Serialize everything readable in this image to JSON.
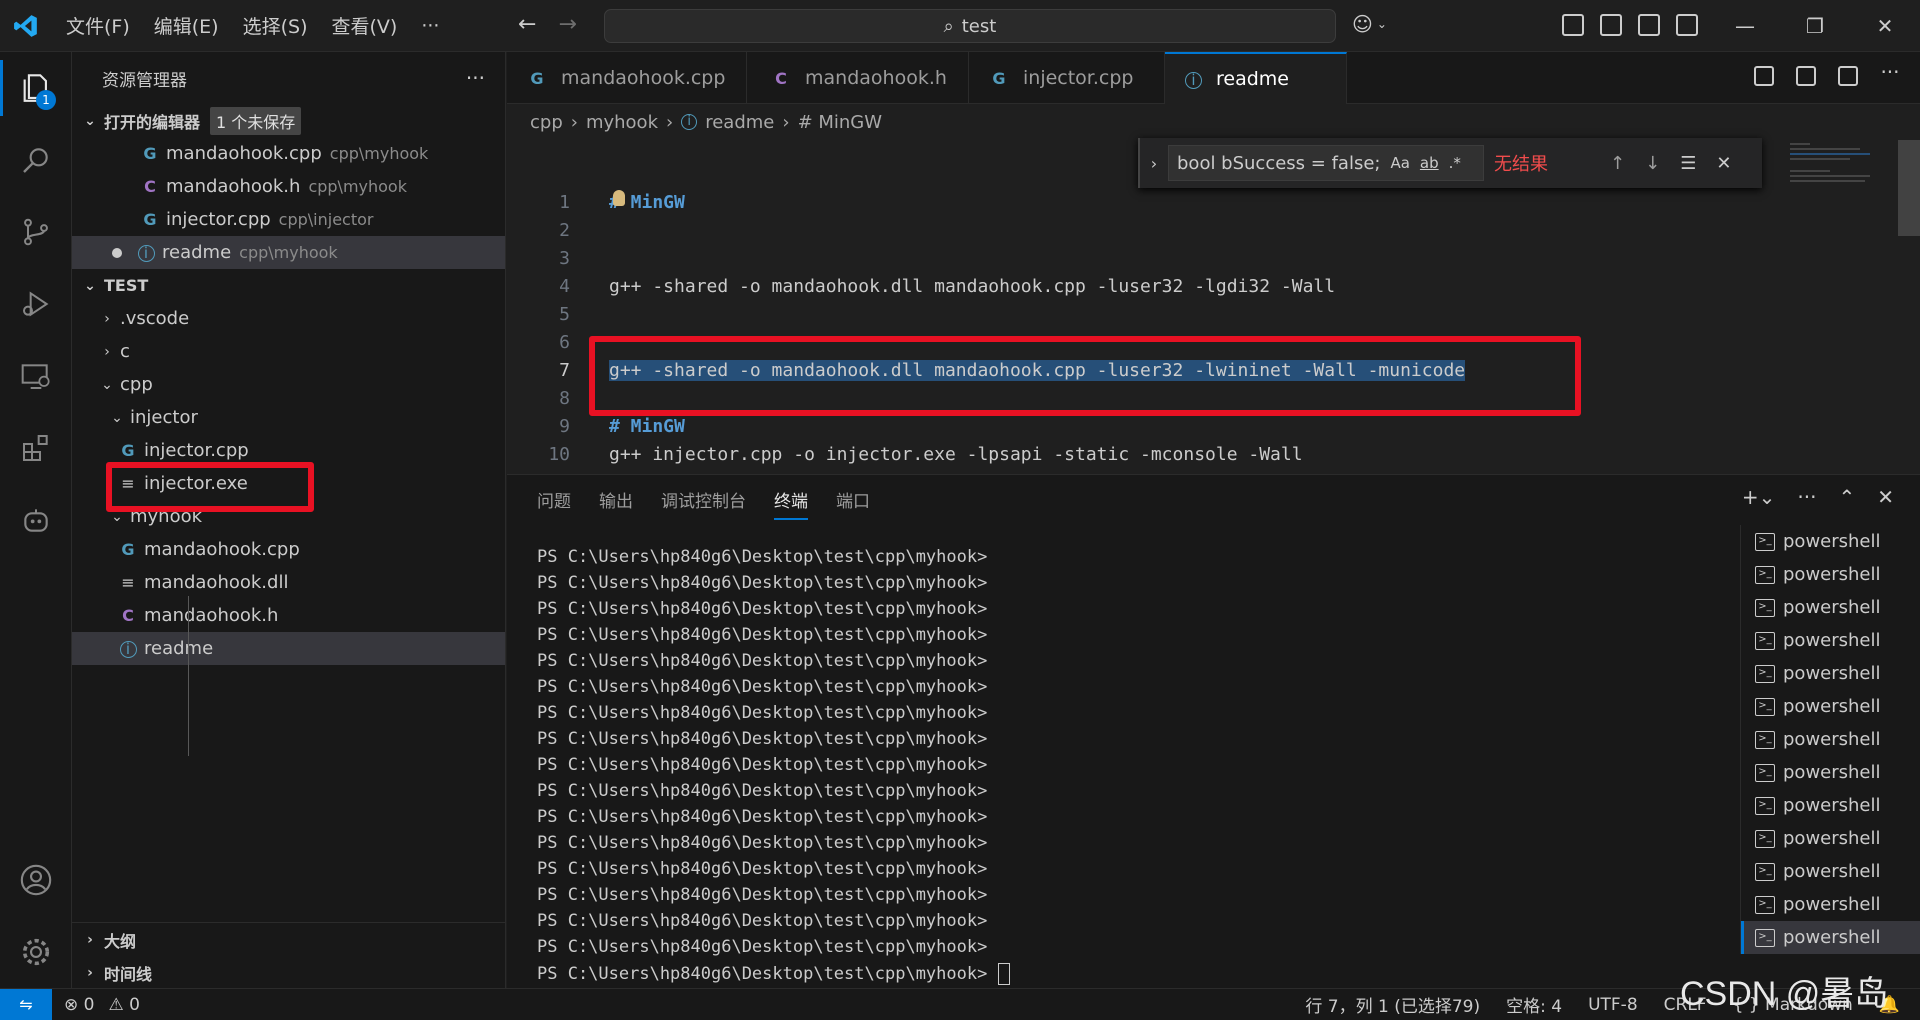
{
  "titlebar": {
    "menu": [
      "文件(F)",
      "编辑(E)",
      "选择(S)",
      "查看(V)",
      "···"
    ],
    "search_text": "test",
    "window_controls": [
      "—",
      "❐",
      "✕"
    ]
  },
  "activity": {
    "explorer_badge": "1"
  },
  "sidebar": {
    "title": "资源管理器",
    "more": "···",
    "open_editors": {
      "title": "打开的编辑器",
      "unsaved": "1 个未保存",
      "items": [
        {
          "icon": "G",
          "name": "mandaohook.cpp",
          "path": "cpp\\myhook"
        },
        {
          "icon": "C",
          "name": "mandaohook.h",
          "path": "cpp\\myhook"
        },
        {
          "icon": "G",
          "name": "injector.cpp",
          "path": "cpp\\injector"
        },
        {
          "icon": "i",
          "name": "readme",
          "path": "cpp\\myhook"
        }
      ]
    },
    "workspace": {
      "title": "TEST",
      "items": [
        {
          "name": ".vscode"
        },
        {
          "name": "c"
        },
        {
          "name": "cpp"
        },
        {
          "name": "injector"
        },
        {
          "name": "injector.cpp"
        },
        {
          "name": "injector.exe"
        },
        {
          "name": "myhook"
        },
        {
          "name": "mandaohook.cpp"
        },
        {
          "name": "mandaohook.dll"
        },
        {
          "name": "mandaohook.h"
        },
        {
          "name": "readme"
        }
      ]
    },
    "outline": "大纲",
    "timeline": "时间线"
  },
  "tabs": [
    {
      "icon": "G",
      "label": "mandaohook.cpp"
    },
    {
      "icon": "C",
      "label": "mandaohook.h"
    },
    {
      "icon": "G",
      "label": "injector.cpp"
    },
    {
      "icon": "i",
      "label": "readme"
    }
  ],
  "breadcrumb": [
    "cpp",
    "myhook",
    "readme",
    "# MinGW"
  ],
  "editor": {
    "lines": [
      {
        "n": "1",
        "text": "# MinGW"
      },
      {
        "n": "2",
        "text": ""
      },
      {
        "n": "3",
        "text": ""
      },
      {
        "n": "4",
        "text": "g++ -shared -o mandaohook.dll mandaohook.cpp -luser32 -lgdi32 -Wall"
      },
      {
        "n": "5",
        "text": ""
      },
      {
        "n": "6",
        "text": ""
      },
      {
        "n": "7",
        "text": "g++ -shared -o mandaohook.dll mandaohook.cpp -luser32 -lwininet -Wall -municode"
      },
      {
        "n": "8",
        "text": ""
      },
      {
        "n": "9",
        "text": "# MinGW"
      },
      {
        "n": "10",
        "text": "g++ injector.cpp -o injector.exe -lpsapi -static -mconsole -Wall"
      }
    ]
  },
  "find": {
    "query": "bool bSuccess = false;",
    "opt_case": "Aa",
    "opt_word": "ab",
    "opt_regex": ".*",
    "result": "无结果"
  },
  "panel": {
    "tabs": [
      "问题",
      "输出",
      "调试控制台",
      "终端",
      "端口"
    ],
    "prompt": "PS C:\\Users\\hp840g6\\Desktop\\test\\cpp\\myhook>",
    "terminals_label": "powershell"
  },
  "status": {
    "errors": "0",
    "warnings": "0",
    "position": "行 7，列 1 (已选择79)",
    "spaces": "空格: 4",
    "encoding": "UTF-8",
    "eol": "CRLF",
    "language": "Markdown",
    "watermark": "CSDN @暑岛"
  },
  "colors": {
    "accent": "#0078d4",
    "highlight_box": "#e81123",
    "selection": "#264f78"
  }
}
